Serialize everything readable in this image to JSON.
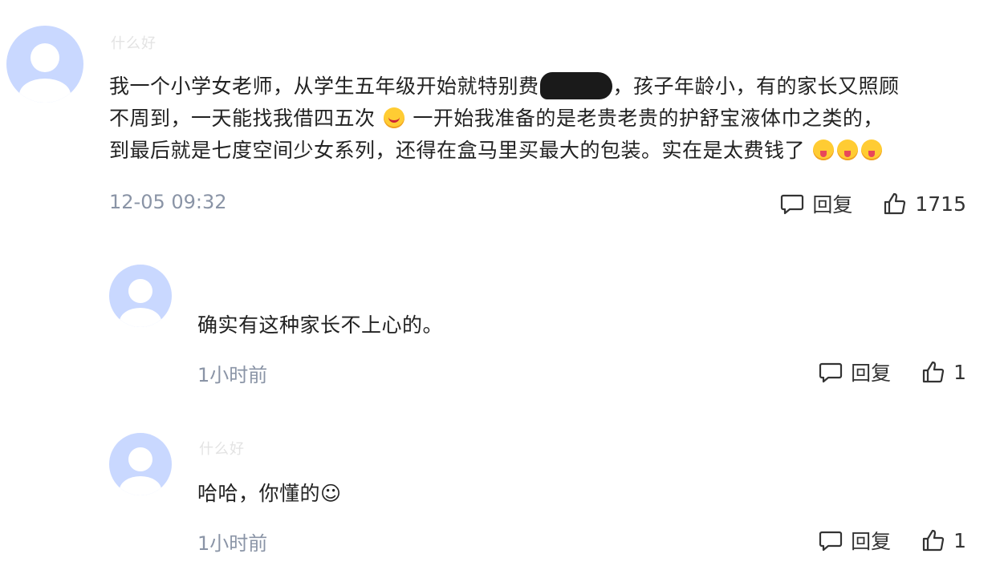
{
  "comments": [
    {
      "username": "什么好",
      "text_part1": "我一个小学女老师，从学生五年级开始就特别费",
      "text_part2": "，孩子年龄小，有的家长又照顾",
      "text_line2a": "不周到，一天能找我借四五次",
      "text_line2b": "一开始我准备的是老贵老贵的护舒宝液体巾之类的，",
      "text_line3": "到最后就是七度空间少女系列，还得在盒马里买最大的包装。实在是太费钱了",
      "time": "12-05 09:32",
      "reply_label": "回复",
      "likes": "1715"
    },
    {
      "username": "",
      "text": "确实有这种家长不上心的。",
      "time": "1小时前",
      "reply_label": "回复",
      "likes": "1"
    },
    {
      "username": "什么好",
      "text": "哈哈，你懂的☺",
      "time": "1小时前",
      "reply_label": "回复",
      "likes": "1"
    }
  ],
  "icons": {
    "reply": "comment-bubble-icon",
    "like": "thumbs-up-icon",
    "emoji_smile": "smiling-face-icon",
    "emoji_tongue": "face-with-tongue-icon"
  }
}
